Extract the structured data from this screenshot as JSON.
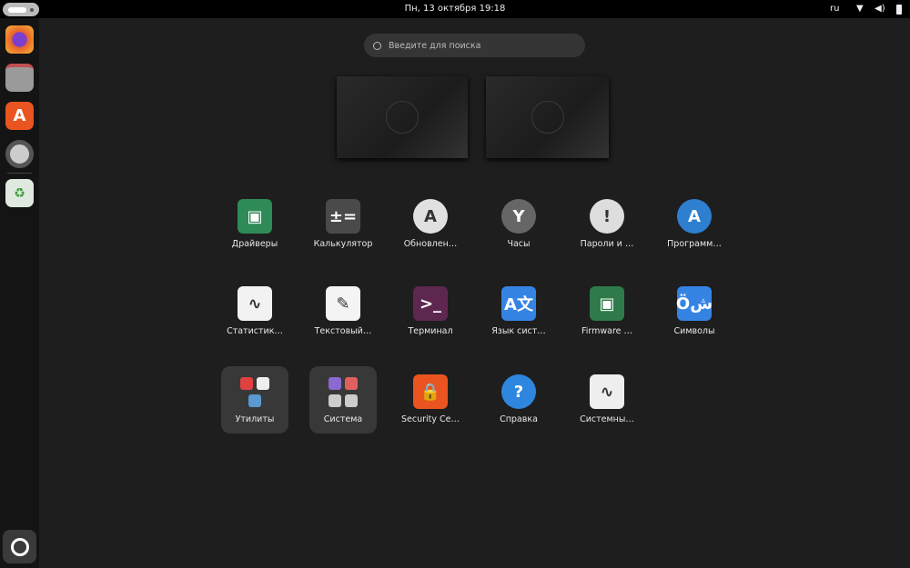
{
  "topbar": {
    "clock": "Пн, 13 октября  19:18",
    "lang": "ru",
    "wifi_icon": "wifi-icon",
    "volume_icon": "volume-icon",
    "battery_icon": "battery-icon"
  },
  "dock": {
    "items": [
      {
        "name": "firefox",
        "icon": "firefox-icon",
        "color": "#e8602c"
      },
      {
        "name": "files",
        "icon": "folder-icon",
        "color": "#8a8a8a"
      },
      {
        "name": "app-center",
        "icon": "app-center-icon",
        "color": "#e95420"
      },
      {
        "name": "settings",
        "icon": "gear-icon",
        "color": "#666"
      },
      {
        "name": "trash",
        "icon": "trash-icon",
        "color": "#5a8a5a"
      }
    ],
    "show_apps_icon": "ubuntu-logo-icon"
  },
  "search": {
    "placeholder": "Введите для поиска"
  },
  "apps": [
    {
      "label": "Драйверы",
      "color": "#2e8b57",
      "glyph": "▣"
    },
    {
      "label": "Калькулятор",
      "color": "#4a4a4a",
      "glyph": "±="
    },
    {
      "label": "Обновлен…",
      "color": "#e0e0e0",
      "glyph": "A"
    },
    {
      "label": "Часы",
      "color": "#666",
      "glyph": "Y"
    },
    {
      "label": "Пароли и …",
      "color": "#ddd",
      "glyph": "!"
    },
    {
      "label": "Программ…",
      "color": "#2e7fd0",
      "glyph": "A"
    },
    {
      "label": "Статистик…",
      "color": "#f2f2f2",
      "glyph": "∿"
    },
    {
      "label": "Текстовый…",
      "color": "#f4f4f4",
      "glyph": "✎"
    },
    {
      "label": "Терминал",
      "color": "#5e2750",
      "glyph": ">_"
    },
    {
      "label": "Язык сист…",
      "color": "#3584e4",
      "glyph": "A文"
    },
    {
      "label": "Firmware …",
      "color": "#2f7a4a",
      "glyph": "▣"
    },
    {
      "label": "Символы",
      "color": "#3584e4",
      "glyph": "Öش"
    },
    {
      "label": "Утилиты",
      "folder": true,
      "minis": [
        "#e04040",
        "#eee",
        "#5a9ad0"
      ]
    },
    {
      "label": "Система",
      "folder": true,
      "minis": [
        "#8a6ad0",
        "#e06060",
        "#ccc",
        "#ccc"
      ]
    },
    {
      "label": "Security Ce…",
      "color": "#e95420",
      "glyph": "🔒"
    },
    {
      "label": "Справка",
      "color": "#2e86de",
      "glyph": "?"
    },
    {
      "label": "Системны…",
      "color": "#eee",
      "glyph": "∿"
    }
  ]
}
